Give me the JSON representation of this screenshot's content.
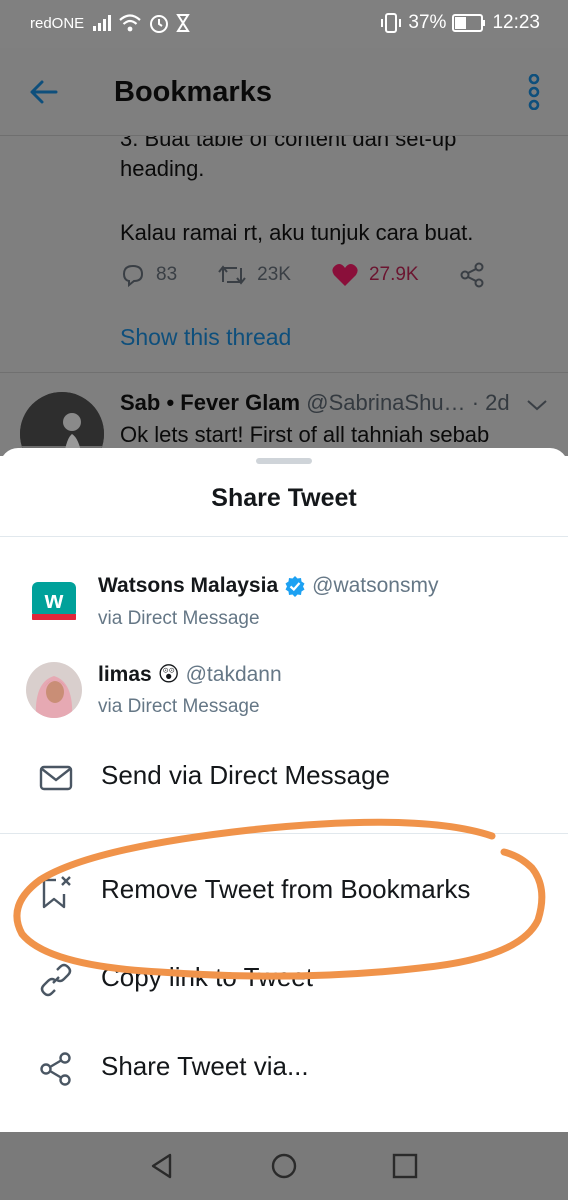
{
  "status_bar": {
    "carrier": "redONE",
    "battery_percent": "37%",
    "time": "12:23"
  },
  "app_bar": {
    "title": "Bookmarks"
  },
  "feed": {
    "tweet_lines": [
      "3. Buat table of content dan set-up",
      "heading.",
      "Kalau ramai rt, aku tunjuk cara buat."
    ],
    "replies": "83",
    "retweets": "23K",
    "likes": "27.9K",
    "show_thread": "Show this thread",
    "next_tweet": {
      "display_name": "Sab • Fever Glam",
      "handle": "@SabrinaShu…",
      "time": "· 2d",
      "text": "Ok lets start! First of all tahniah sebab"
    }
  },
  "share_sheet": {
    "title": "Share Tweet",
    "contacts": [
      {
        "name": "Watsons Malaysia",
        "handle": "@watsonsmy",
        "via": "via Direct Message",
        "verified": true,
        "avatar_letter": "w",
        "avatar_color": "#00a19a"
      },
      {
        "name": "limas",
        "emoji": "😲",
        "handle": "@takdann",
        "via": "via Direct Message",
        "verified": false
      }
    ],
    "actions": [
      {
        "label": "Send via Direct Message",
        "icon": "envelope-icon"
      },
      {
        "label": "Remove Tweet from Bookmarks",
        "icon": "bookmark-remove-icon"
      },
      {
        "label": "Copy link to Tweet",
        "icon": "link-icon"
      },
      {
        "label": "Share Tweet via...",
        "icon": "share-icon"
      }
    ]
  },
  "colors": {
    "accent": "#1da1f2",
    "dim_overlay": "#7f7f7f",
    "annotation": "#f0934a",
    "secondary_text": "#657786"
  }
}
